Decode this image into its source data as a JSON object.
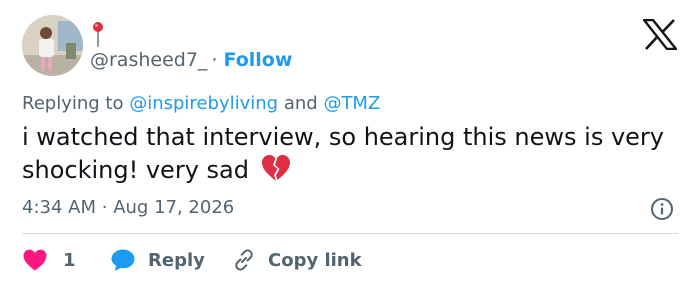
{
  "author": {
    "handle": "@rasheed7_",
    "follow_label": "Follow",
    "separator": "·",
    "avatar_icon": "profile-photo",
    "badge_icon": "round-pushpin-emoji"
  },
  "brand": {
    "logo_icon": "x-logo"
  },
  "reply_context": {
    "prefix": "Replying to",
    "first_mention": "@inspirebyliving",
    "conjunction": "and",
    "second_mention": "@TMZ"
  },
  "tweet": {
    "text": "i watched that interview, so hearing this news is very shocking! very sad",
    "emoji_icon": "broken-heart-emoji"
  },
  "meta": {
    "time": "4:34 AM",
    "separator": "·",
    "date": "Aug 17, 2026",
    "info_icon": "info-icon"
  },
  "actions": {
    "like_count": "1",
    "reply_label": "Reply",
    "copy_link_label": "Copy link"
  },
  "colors": {
    "accent": "#1d9bf0",
    "like": "#f91880",
    "text": "#0f1419",
    "secondary": "#536471",
    "divider": "#cfd9de",
    "broken_heart": "#dd2e44"
  }
}
